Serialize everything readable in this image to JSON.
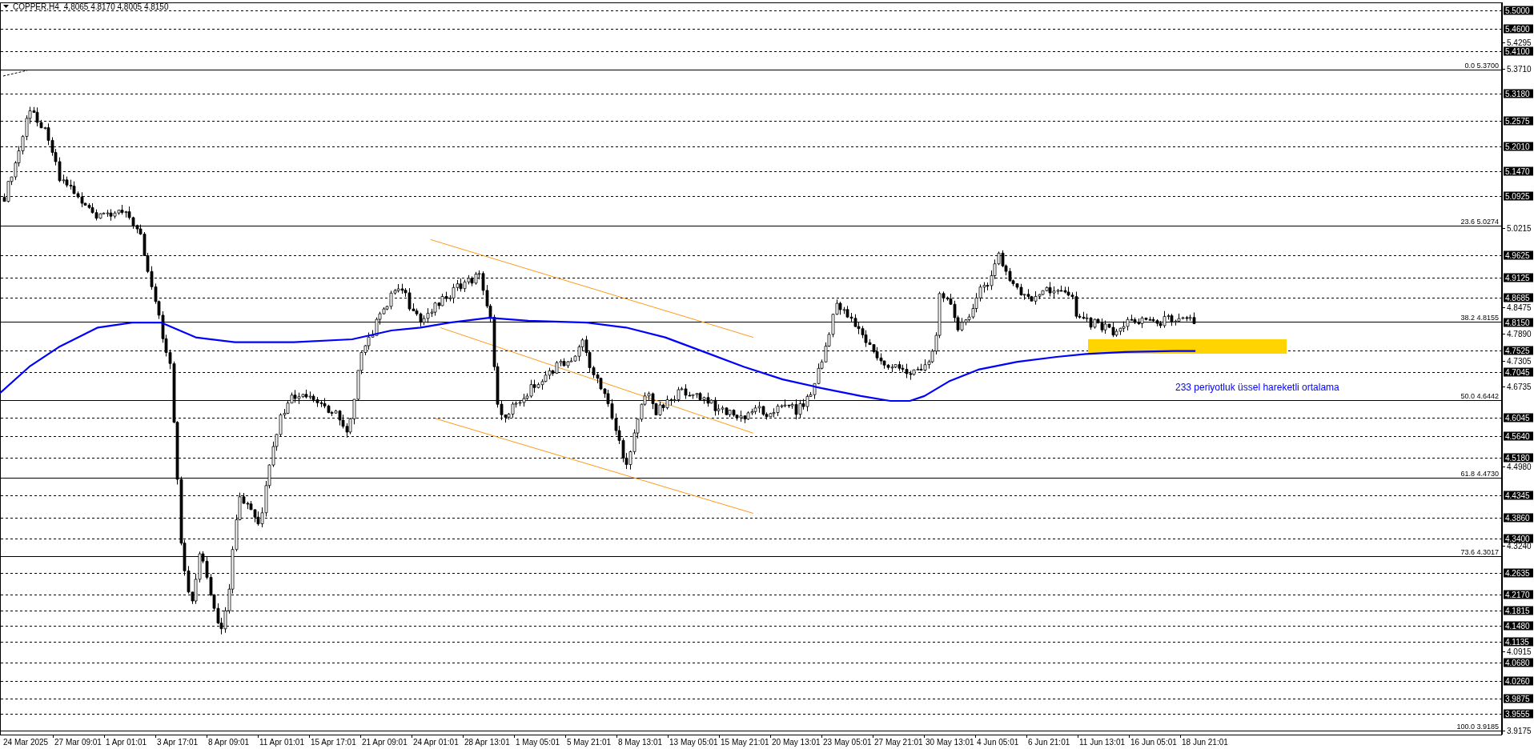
{
  "header": {
    "title": "COPPER,H4",
    "values": [
      "4.8065",
      "4.8170",
      "4.8005",
      "4.8150"
    ]
  },
  "chart": {
    "price_scale": [
      "5.4295",
      "5.3710",
      "5.0215",
      "4.8475",
      "4.7890",
      "4.7305",
      "4.6735",
      "4.4980",
      "4.3240",
      "4.0915",
      "3.9175"
    ],
    "price_labels": [
      "5.5000",
      "5.4600",
      "5.4100",
      "5.3180",
      "5.2575",
      "5.2010",
      "5.1470",
      "5.0925",
      "4.9625",
      "4.9125",
      "4.8685",
      "4.8150",
      "4.7525",
      "4.7045",
      "4.6045",
      "4.5640",
      "4.5180",
      "4.4345",
      "4.3860",
      "4.3400",
      "4.2635",
      "4.2170",
      "4.1815",
      "4.1480",
      "4.1135",
      "4.0680",
      "4.0260",
      "3.9875",
      "3.9555"
    ],
    "fibonacci_levels": [
      {
        "label": "0.0 5.3700"
      },
      {
        "label": "23.6 5.0274"
      },
      {
        "label": "38.2 4.8155"
      },
      {
        "label": "50.0 4.6442"
      },
      {
        "label": "61.8 4.4730"
      },
      {
        "label": "73.6 4.3017"
      },
      {
        "label": "100.0 3.9185"
      }
    ],
    "annotation": "233 periyotluk üssel hareketli ortalama",
    "time_axis": [
      "24 Mar 2025",
      "27 Mar 09:01",
      "1 Apr 01:01",
      "3 Apr 17:01",
      "8 Apr 09:01",
      "11 Apr 01:01",
      "15 Apr 17:01",
      "21 Apr 09:01",
      "24 Apr 01:01",
      "28 Apr 13:01",
      "1 May 05:01",
      "5 May 21:01",
      "8 May 13:01",
      "13 May 05:01",
      "15 May 21:01",
      "20 May 13:01",
      "23 May 05:01",
      "27 May 21:01",
      "30 May 13:01",
      "4 Jun 05:01",
      "6 Jun 21:01",
      "11 Jun 13:01",
      "16 Jun 05:01",
      "18 Jun 21:01"
    ]
  }
}
